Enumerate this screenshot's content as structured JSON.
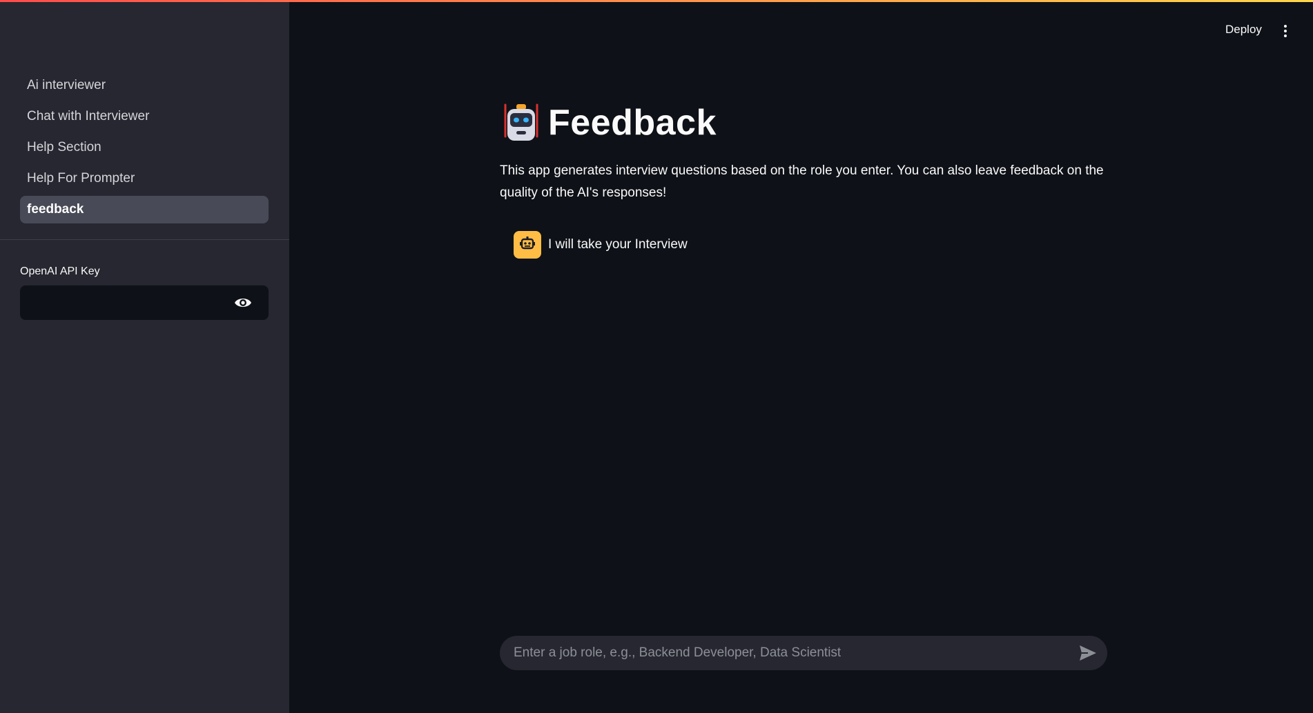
{
  "sidebar": {
    "nav_items": [
      {
        "label": "Ai interviewer",
        "active": false
      },
      {
        "label": "Chat with Interviewer",
        "active": false
      },
      {
        "label": "Help Section",
        "active": false
      },
      {
        "label": "Help For Prompter",
        "active": false
      },
      {
        "label": "feedback",
        "active": true
      }
    ],
    "api_key_label": "OpenAI API Key",
    "api_key_value": "",
    "visibility_icon": "eye-icon"
  },
  "header": {
    "deploy_label": "Deploy",
    "menu_icon": "vertical-dots-icon"
  },
  "main": {
    "title_icon": "robot-emoji",
    "title": "Feedback",
    "description": "This app generates interview questions based on the role you enter. You can also leave feedback on the quality of the AI's responses!",
    "messages": [
      {
        "avatar_icon": "robot-icon",
        "text": "I will take your Interview"
      }
    ],
    "chat_input": {
      "placeholder": "Enter a job role, e.g., Backend Developer, Data Scientist",
      "value": "",
      "send_icon": "send-icon"
    }
  },
  "colors": {
    "background": "#0e1117",
    "sidebar": "#262730",
    "active_nav": "#484b57",
    "bot_avatar": "#ffbd45",
    "top_gradient_start": "#ff4b4b",
    "top_gradient_end": "#ffd74b"
  }
}
